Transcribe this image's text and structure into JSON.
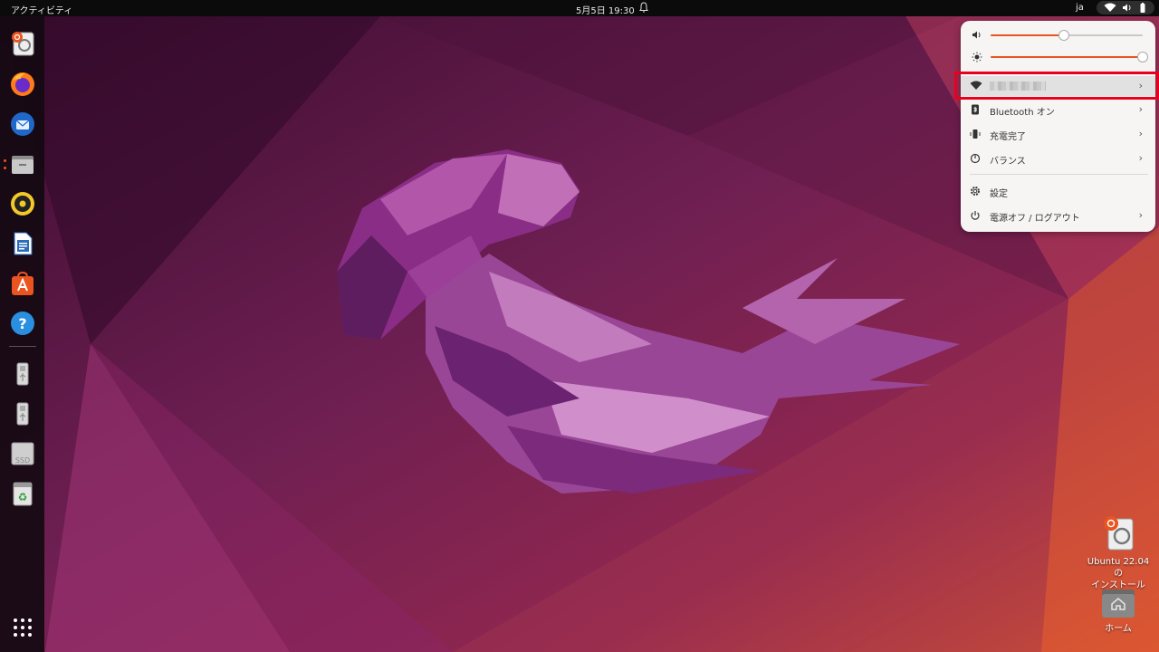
{
  "topbar": {
    "activities": "アクティビティ",
    "clock": "5月5日  19:30",
    "input_method": "ja"
  },
  "dock": {
    "items": [
      {
        "icon": "ubuntu-installer-icon"
      },
      {
        "icon": "firefox-icon"
      },
      {
        "icon": "thunderbird-icon"
      },
      {
        "icon": "files-icon"
      },
      {
        "icon": "rhythmbox-icon"
      },
      {
        "icon": "libreoffice-writer-icon"
      },
      {
        "icon": "app-center-icon"
      },
      {
        "icon": "help-icon"
      },
      {
        "icon": "usb-drive-icon"
      },
      {
        "icon": "usb-drive-icon"
      },
      {
        "icon": "ssd-icon",
        "label": "SSD"
      },
      {
        "icon": "trash-icon"
      },
      {
        "icon": "show-apps-icon"
      }
    ]
  },
  "quick_settings": {
    "volume_level": 0.48,
    "brightness_level": 1.0,
    "wifi": {
      "label": "",
      "chevron": "›"
    },
    "bluetooth": {
      "label": "Bluetooth オン",
      "chevron": "›"
    },
    "battery": {
      "label": "充電完了",
      "chevron": "›"
    },
    "power_mode": {
      "label": "バランス",
      "chevron": "›"
    },
    "settings": {
      "label": "設定"
    },
    "power": {
      "label": "電源オフ / ログアウト",
      "chevron": "›"
    }
  },
  "desktop": {
    "installer": {
      "line1": "Ubuntu 22.04 の",
      "line2": "インストール"
    },
    "home": {
      "label": "ホーム"
    }
  },
  "colors": {
    "accent": "#e95420",
    "highlight": "#e8001c"
  }
}
